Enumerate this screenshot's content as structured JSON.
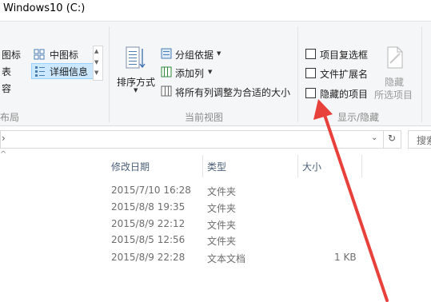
{
  "window": {
    "title": "Windows10 (C:)"
  },
  "ribbon": {
    "layout_group": {
      "items": [
        "图标",
        "表",
        "容"
      ],
      "medium_icons": "中图标",
      "details": "详细信息",
      "label": "布局"
    },
    "current_view": {
      "sort_by": "排序方式",
      "group_by": "分组依据",
      "add_column": "添加列",
      "fit_columns": "将所有列调整为合适的大小",
      "label": "当前视图"
    },
    "show_hide": {
      "item_checkboxes": "项目复选框",
      "file_extensions": "文件扩展名",
      "hidden_items": "隐藏的项目",
      "hide_line1": "隐藏",
      "hide_line2": "所选项目",
      "label": "显示/隐藏"
    }
  },
  "address": {
    "chevron": "›",
    "search_placeholder": "搜索"
  },
  "columns": {
    "date": "修改日期",
    "type": "类型",
    "size": "大小"
  },
  "rows": [
    {
      "date": "2015/7/10 16:28",
      "type": "文件夹",
      "size": ""
    },
    {
      "date": "2015/8/8 19:35",
      "type": "文件夹",
      "size": ""
    },
    {
      "date": "2015/8/9 22:12",
      "type": "文件夹",
      "size": ""
    },
    {
      "date": "2015/8/5 12:56",
      "type": "文件夹",
      "size": ""
    },
    {
      "date": "2015/8/9 22:28",
      "type": "文本文档",
      "size": "1 KB"
    }
  ],
  "colors": {
    "arrow": "#e8413c",
    "selected_bg": "#cce8ff",
    "selected_border": "#99d1ff"
  }
}
